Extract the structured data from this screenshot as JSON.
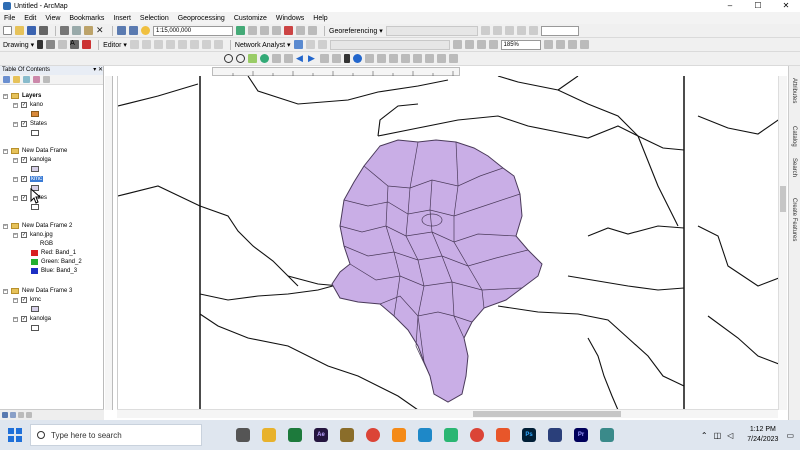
{
  "window": {
    "title": "Untitled - ArcMap",
    "controls": [
      "–",
      "☐",
      "✕"
    ]
  },
  "menu": [
    "File",
    "Edit",
    "View",
    "Bookmarks",
    "Insert",
    "Selection",
    "Geoprocessing",
    "Customize",
    "Windows",
    "Help"
  ],
  "toolbar1": {
    "scale": "1:15,000,000",
    "georef_label": "Georeferencing ▾"
  },
  "toolbar2": {
    "drawing_label": "Drawing ▾",
    "editor_label": "Editor ▾",
    "network_label": "Network Analyst ▾",
    "zoom": "185%"
  },
  "toc": {
    "title": "Table Of Contents",
    "pin": "▾ ✕",
    "groups": [
      {
        "name": "Layers",
        "layers": [
          {
            "name": "kano"
          },
          {
            "name": "States"
          }
        ]
      },
      {
        "name": "New Data Frame",
        "layers": [
          {
            "name": "kanolga"
          },
          {
            "name": "kmc"
          },
          {
            "name": "States"
          }
        ]
      },
      {
        "name": "New Data Frame 2",
        "layers": [
          {
            "name": "kano.jpg"
          }
        ],
        "rgb_label": "RGB",
        "bands": [
          "Red:   Band_1",
          "Green: Band_2",
          "Blue:  Band_3"
        ]
      },
      {
        "name": "New Data Frame 3",
        "layers": [
          {
            "name": "kmc"
          },
          {
            "name": "kanolga"
          }
        ]
      }
    ]
  },
  "right_dock": [
    "Attributes",
    "Catalog",
    "Search",
    "Create Features"
  ],
  "taskbar": {
    "search_placeholder": "Type here to search",
    "time": "1:12 PM",
    "date": "7/24/2023"
  },
  "colors": {
    "polygon_fill": "#c9aee6",
    "polygon_stroke": "#4a3a5a",
    "selection": "#3a7bd5"
  }
}
